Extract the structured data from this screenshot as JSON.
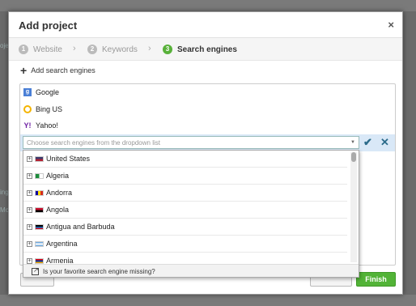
{
  "background": {
    "fragments": [
      "ojec",
      "ing fa",
      "Mon"
    ]
  },
  "modal": {
    "title": "Add project",
    "close": "×"
  },
  "steps": [
    {
      "num": "1",
      "label": "Website"
    },
    {
      "num": "2",
      "label": "Keywords"
    },
    {
      "num": "3",
      "label": "Search engines"
    }
  ],
  "step_separator": "›",
  "add_engines": {
    "label": "Add search engines"
  },
  "engines": [
    {
      "name": "Google",
      "icon": "google-icon"
    },
    {
      "name": "Bing US",
      "icon": "bing-icon"
    },
    {
      "name": "Yahoo!",
      "icon": "yahoo-icon"
    }
  ],
  "engine_select": {
    "placeholder": "Choose search engines from the dropdown list",
    "confirm": "✔",
    "cancel": "✕"
  },
  "dropdown": {
    "items": [
      {
        "label": "United States",
        "flag_color": "#3c3b6e"
      },
      {
        "label": "Algeria",
        "flag_color": "#1c8c3c"
      },
      {
        "label": "Andorra",
        "flag_color": "#d52b1e"
      },
      {
        "label": "Angola",
        "flag_color": "#c8102e"
      },
      {
        "label": "Antigua and Barbuda",
        "flag_color": "#ce1126"
      },
      {
        "label": "Argentina",
        "flag_color": "#74acdf"
      },
      {
        "label": "Armenia",
        "flag_color": "#d90012"
      }
    ],
    "footer": "Is your favorite search engine missing?"
  },
  "footer": {
    "finish": "Finish"
  },
  "colors": {
    "accent_green": "#52b337",
    "selection_bg": "#d9e8f7"
  }
}
